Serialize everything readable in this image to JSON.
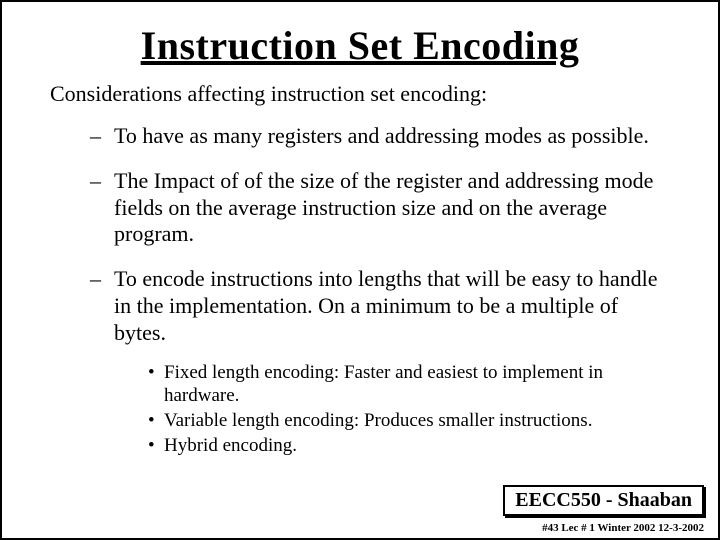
{
  "title": "Instruction Set Encoding",
  "subtitle": "Considerations affecting instruction set encoding:",
  "bullets": [
    {
      "text": "To have as many registers and addressing modes as possible."
    },
    {
      "text": "The Impact of of the size of the register and addressing mode fields on the average instruction size and on the average program."
    },
    {
      "text": "To encode instructions into lengths that will be easy to handle in the implementation.  On a minimum to be a multiple of bytes.",
      "sub": [
        "Fixed length encoding:  Faster and easiest to implement in hardware.",
        "Variable length encoding:  Produces smaller instructions.",
        "Hybrid encoding."
      ]
    }
  ],
  "footer_box": "EECC550 - Shaaban",
  "footer_line": "#43  Lec # 1 Winter 2002  12-3-2002"
}
